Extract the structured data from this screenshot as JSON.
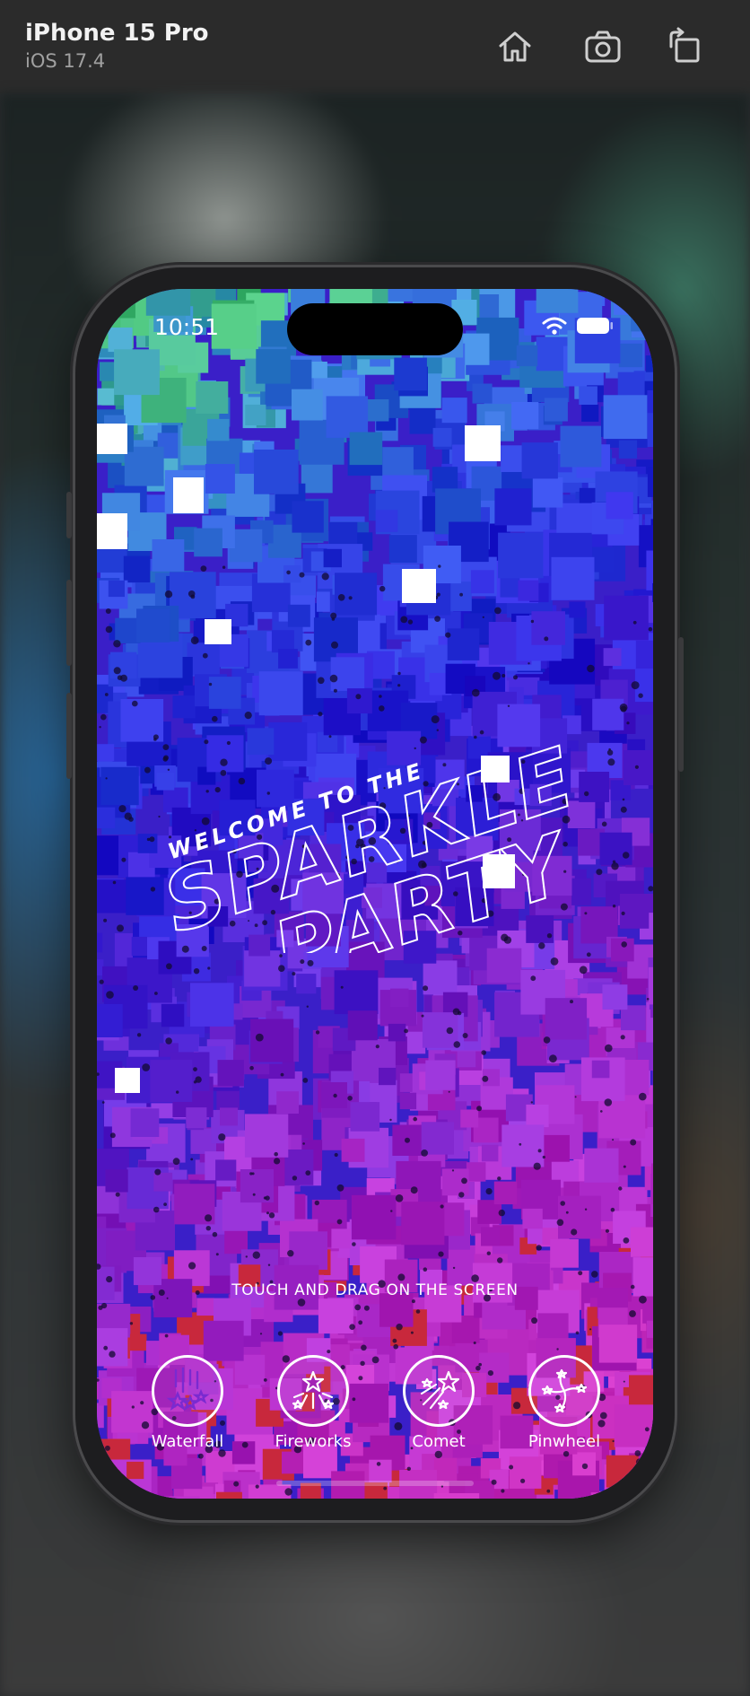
{
  "toolbar": {
    "device_name": "iPhone 15 Pro",
    "os_version": "iOS 17.4",
    "buttons": [
      {
        "name": "home",
        "icon": "home-icon"
      },
      {
        "name": "screenshot",
        "icon": "camera-icon"
      },
      {
        "name": "rotate",
        "icon": "rotate-icon"
      }
    ]
  },
  "status_bar": {
    "time": "10:51",
    "icons": [
      "wifi-icon",
      "battery-icon"
    ]
  },
  "app": {
    "title_small": "WELCOME TO THE",
    "title_line1": "SPARKLE",
    "title_line2": "PARTY",
    "hint": "TOUCH AND DRAG ON THE SCREEN",
    "modes": [
      {
        "label": "Waterfall",
        "icon": "waterfall-icon",
        "selected": true
      },
      {
        "label": "Fireworks",
        "icon": "fireworks-icon",
        "selected": false
      },
      {
        "label": "Comet",
        "icon": "comet-icon",
        "selected": false
      },
      {
        "label": "Pinwheel",
        "icon": "pinwheel-icon",
        "selected": false
      }
    ]
  },
  "colors": {
    "toolbar_bg": "#2b2b2b",
    "screen_top": "#3fb27a",
    "screen_mid": "#2a22d6",
    "screen_bottom": "#c42ab8",
    "accent_purple": "#7a2ad0"
  }
}
